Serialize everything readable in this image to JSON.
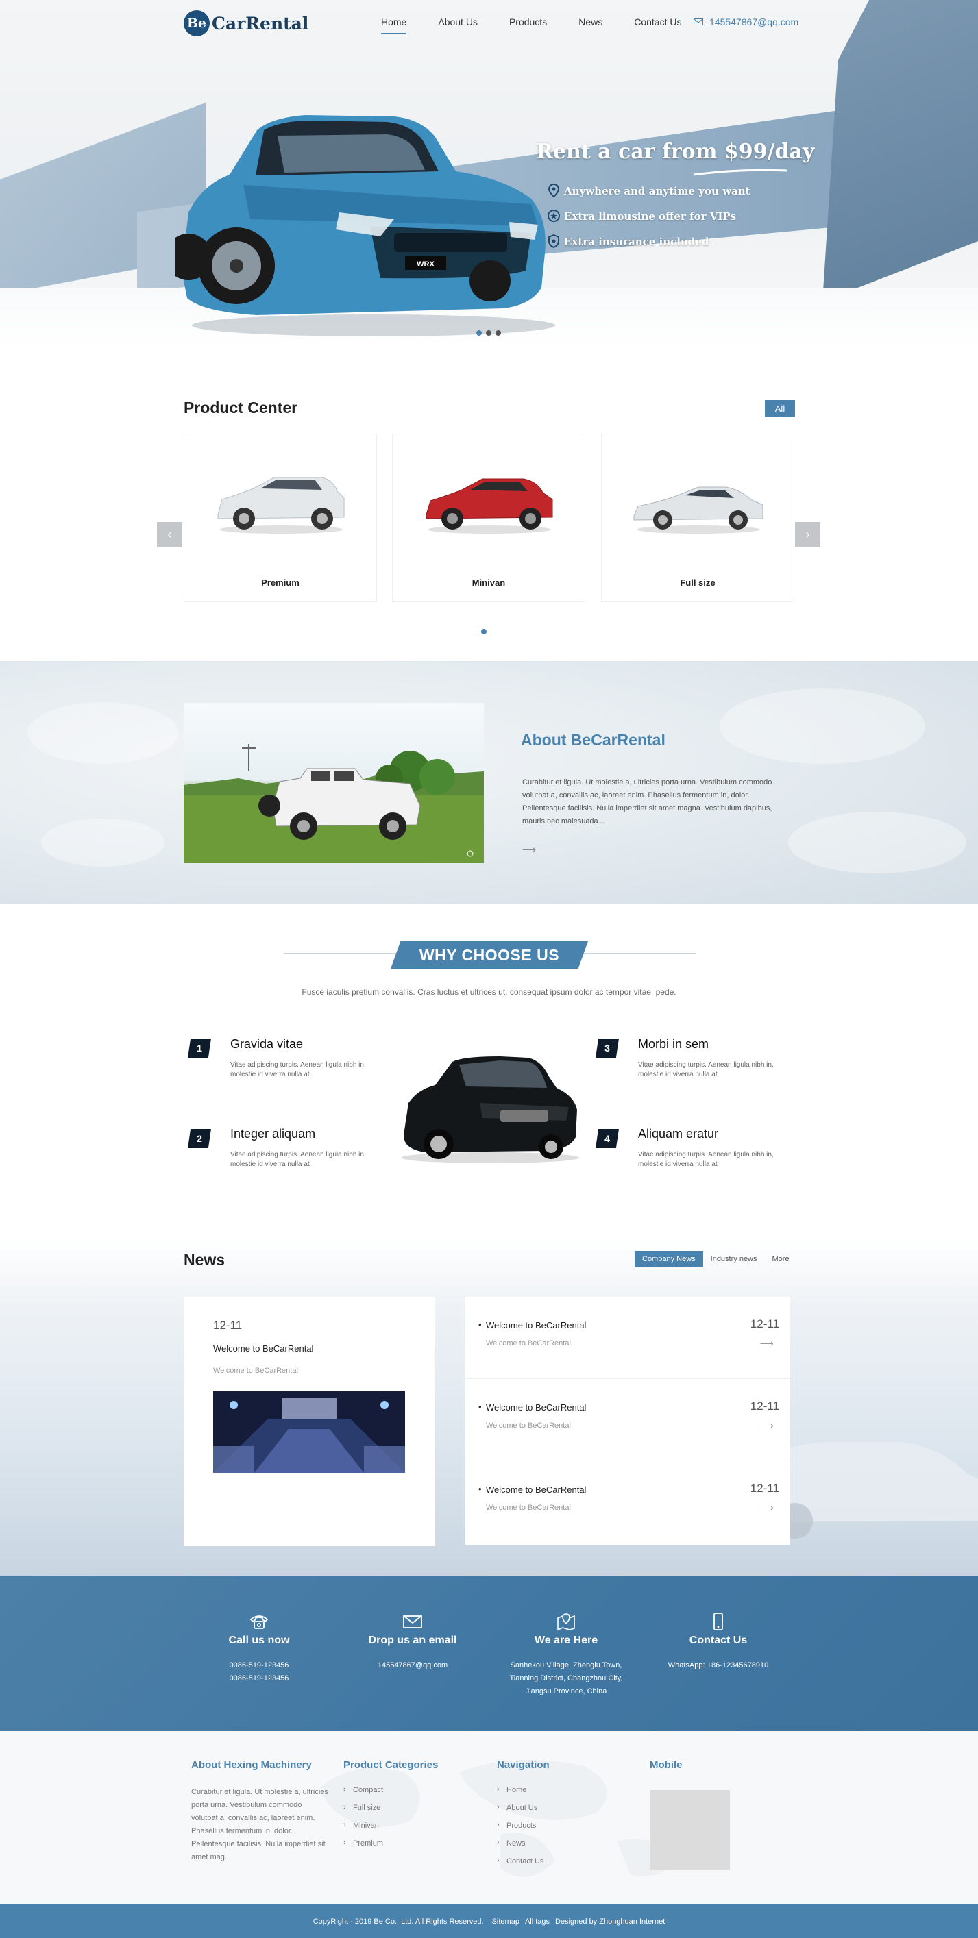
{
  "brand": {
    "logo_mark": "Be",
    "logo_name": "CarRental"
  },
  "nav": {
    "items": [
      "Home",
      "About Us",
      "Products",
      "News",
      "Contact Us"
    ],
    "email": "145547867@qq.com"
  },
  "hero": {
    "title": "Rent a car from $99/day",
    "features": [
      {
        "icon": "location-pin-icon",
        "text": "Anywhere and anytime you want"
      },
      {
        "icon": "star-badge-icon",
        "text": "Extra limousine offer for VIPs"
      },
      {
        "icon": "shield-icon",
        "text": "Extra insurance included"
      }
    ],
    "car_plate": "WRX"
  },
  "products": {
    "title": "Product Center",
    "all_label": "All",
    "prev_label": "‹",
    "next_label": "›",
    "items": [
      {
        "label": "Premium",
        "color": "#e9ecef"
      },
      {
        "label": "Minivan",
        "color": "#c0262a"
      },
      {
        "label": "Full size",
        "color": "#dfe3e6"
      }
    ]
  },
  "about": {
    "title": "About BeCarRental",
    "text": "Curabitur et ligula. Ut molestie a, ultricies porta urna. Vestibulum commodo volutpat a, convallis ac, laoreet enim. Phasellus fermentum in, dolor. Pellentesque facilisis. Nulla imperdiet sit amet magna. Vestibulum dapibus, mauris nec malesuada...",
    "more": "⟶"
  },
  "why": {
    "title": "WHY CHOOSE US",
    "subtitle": "Fusce iaculis pretium convallis. Cras luctus et ultrices ut, consequat ipsum dolor ac tempor vitae, pede.",
    "items": [
      {
        "num": "1",
        "title": "Gravida vitae",
        "text": "Vitae adipiscing turpis. Aenean ligula nibh in, molestie id viverra nulla at"
      },
      {
        "num": "2",
        "title": "Integer aliquam",
        "text": "Vitae adipiscing turpis. Aenean ligula nibh in, molestie id viverra nulla at"
      },
      {
        "num": "3",
        "title": "Morbi in sem",
        "text": "Vitae adipiscing turpis. Aenean ligula nibh in, molestie id viverra nulla at"
      },
      {
        "num": "4",
        "title": "Aliquam eratur",
        "text": "Vitae adipiscing turpis. Aenean ligula nibh in, molestie id viverra nulla at"
      }
    ]
  },
  "news": {
    "title": "News",
    "tabs": [
      "Company News",
      "Industry news",
      "More"
    ],
    "featured": {
      "date": "12-11",
      "title": "Welcome to BeCarRental",
      "summary": "Welcome to BeCarRental"
    },
    "list": [
      {
        "title": "Welcome to BeCarRental",
        "summary": "Welcome to BeCarRental",
        "date": "12-11",
        "arrow": "⟶"
      },
      {
        "title": "Welcome to BeCarRental",
        "summary": "Welcome to BeCarRental",
        "date": "12-11",
        "arrow": "⟶"
      },
      {
        "title": "Welcome to BeCarRental",
        "summary": "Welcome to BeCarRental",
        "date": "12-11",
        "arrow": "⟶"
      }
    ]
  },
  "contact": {
    "columns": [
      {
        "icon": "phone-icon",
        "title": "Call us now",
        "lines": [
          "0086-519-123456",
          "0086-519-123456"
        ]
      },
      {
        "icon": "envelope-icon",
        "title": "Drop us an email",
        "lines": [
          "145547867@qq.com"
        ]
      },
      {
        "icon": "map-pin-icon",
        "title": "We are Here",
        "lines": [
          "Sanhekou Village, Zhenglu Town,",
          "Tianning District, Changzhou City,",
          "Jiangsu Province, China"
        ]
      },
      {
        "icon": "mobile-icon",
        "title": "Contact Us",
        "lines": [
          "WhatsApp: +86-12345678910"
        ]
      }
    ]
  },
  "footer": {
    "about": {
      "title": "About Hexing Machinery",
      "text": "Curabitur et ligula. Ut molestie a, ultricies porta urna. Vestibulum commodo volutpat a, convallis ac, laoreet enim. Phasellus fermentum in, dolor. Pellentesque facilisis. Nulla imperdiet sit amet mag..."
    },
    "categories": {
      "title": "Product Categories",
      "items": [
        "Compact",
        "Full size",
        "Minivan",
        "Premium"
      ]
    },
    "navigation": {
      "title": "Navigation",
      "items": [
        "Home",
        "About Us",
        "Products",
        "News",
        "Contact Us"
      ]
    },
    "mobile": {
      "title": "Mobile"
    },
    "copyright": "CopyRight · 2019 Be Co., Ltd. All Rights Reserved.",
    "links": [
      "Sitemap",
      "All tags",
      "Designed by Zhonghuan Internet"
    ]
  },
  "colors": {
    "accent": "#4a82ae",
    "dark": "#0d1b2a",
    "hero_car": "#3d8fc0"
  }
}
